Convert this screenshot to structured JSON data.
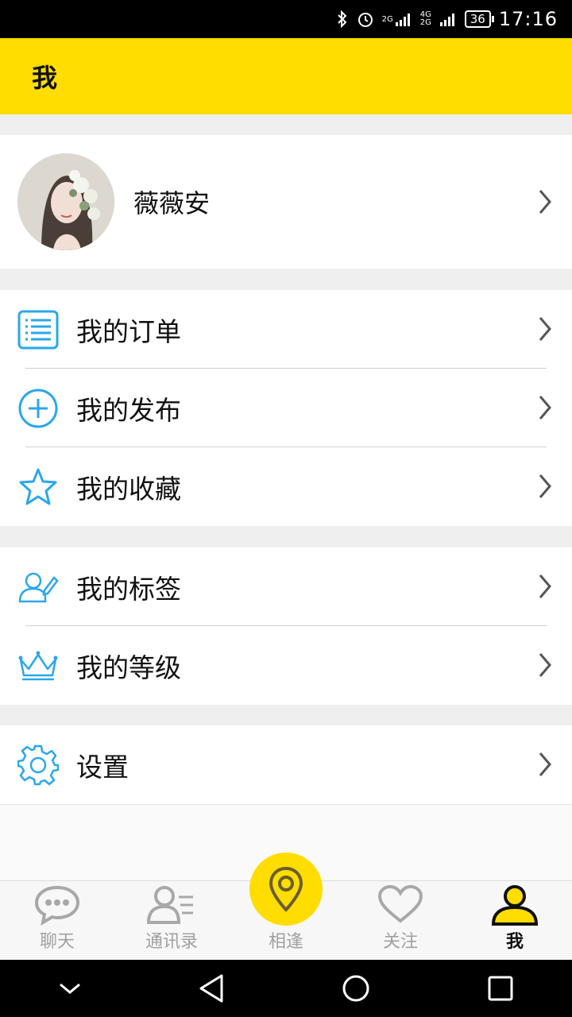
{
  "status_bar": {
    "network1": "2G",
    "network2": "4G 2G",
    "battery": "36",
    "time": "17:16"
  },
  "header": {
    "title": "我"
  },
  "profile": {
    "name": "薇薇安"
  },
  "menu_group1": [
    {
      "label": "我的订单",
      "icon": "list-icon"
    },
    {
      "label": "我的发布",
      "icon": "plus-circle-icon"
    },
    {
      "label": "我的收藏",
      "icon": "star-icon"
    }
  ],
  "menu_group2": [
    {
      "label": "我的标签",
      "icon": "user-edit-icon"
    },
    {
      "label": "我的等级",
      "icon": "crown-icon"
    }
  ],
  "menu_group3": [
    {
      "label": "设置",
      "icon": "gear-icon"
    }
  ],
  "tabbar": {
    "tabs": [
      {
        "label": "聊天",
        "icon": "chat-icon"
      },
      {
        "label": "通讯录",
        "icon": "contacts-icon"
      },
      {
        "label": "相逢",
        "icon": "location-pin-icon"
      },
      {
        "label": "关注",
        "icon": "heart-icon"
      },
      {
        "label": "我",
        "icon": "person-icon"
      }
    ],
    "active": "我"
  },
  "colors": {
    "accent": "#ffdd00",
    "icon_blue": "#2aa7ea"
  }
}
